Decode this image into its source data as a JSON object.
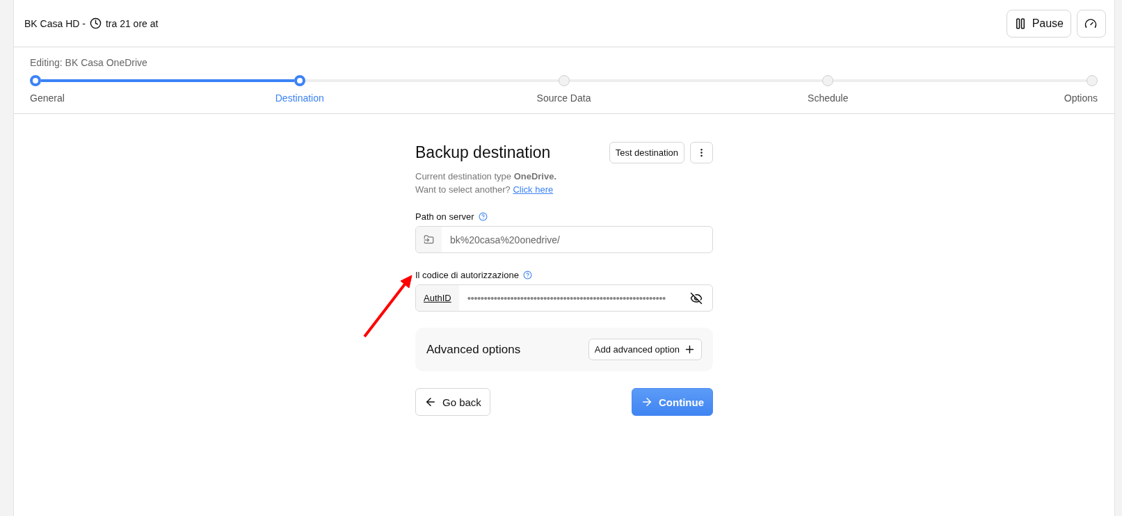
{
  "header": {
    "title": "BK Casa HD -",
    "schedule": "tra 21 ore at",
    "buttons": [
      {
        "kind": "pause",
        "label": "Pause"
      },
      {
        "kind": "gauge"
      }
    ]
  },
  "stepper": {
    "caption": "Editing: BK Casa OneDrive",
    "steps": [
      {
        "label": "General",
        "completed": true,
        "selected": false
      },
      {
        "label": "Destination",
        "completed": true,
        "selected": true
      },
      {
        "label": "Source Data",
        "completed": false,
        "selected": false
      },
      {
        "label": "Schedule",
        "completed": false,
        "selected": false
      },
      {
        "label": "Options",
        "completed": false,
        "selected": false
      }
    ]
  },
  "form": {
    "title": "Backup destination",
    "test_button": "Test destination",
    "intro": "Current destination type **OneDrive.**",
    "intro2": "Want to select another?",
    "link": "Click here",
    "fields": [
      {
        "kind": "path",
        "label": "Path on server",
        "value": "bk%20casa%20onedrive/"
      },
      {
        "kind": "secret",
        "label": "Il codice di autorizzazione",
        "prefix": "AuthID",
        "value": "••••••••••••••••••••••••••••••••••••••••••••••••••••••••••••"
      }
    ],
    "advanced": {
      "title": "Advanced options",
      "button": "Add advanced option"
    },
    "back": "Go back",
    "continue": "Continue"
  },
  "annotation": {
    "kind": "arrow",
    "color": "#ff0000"
  }
}
